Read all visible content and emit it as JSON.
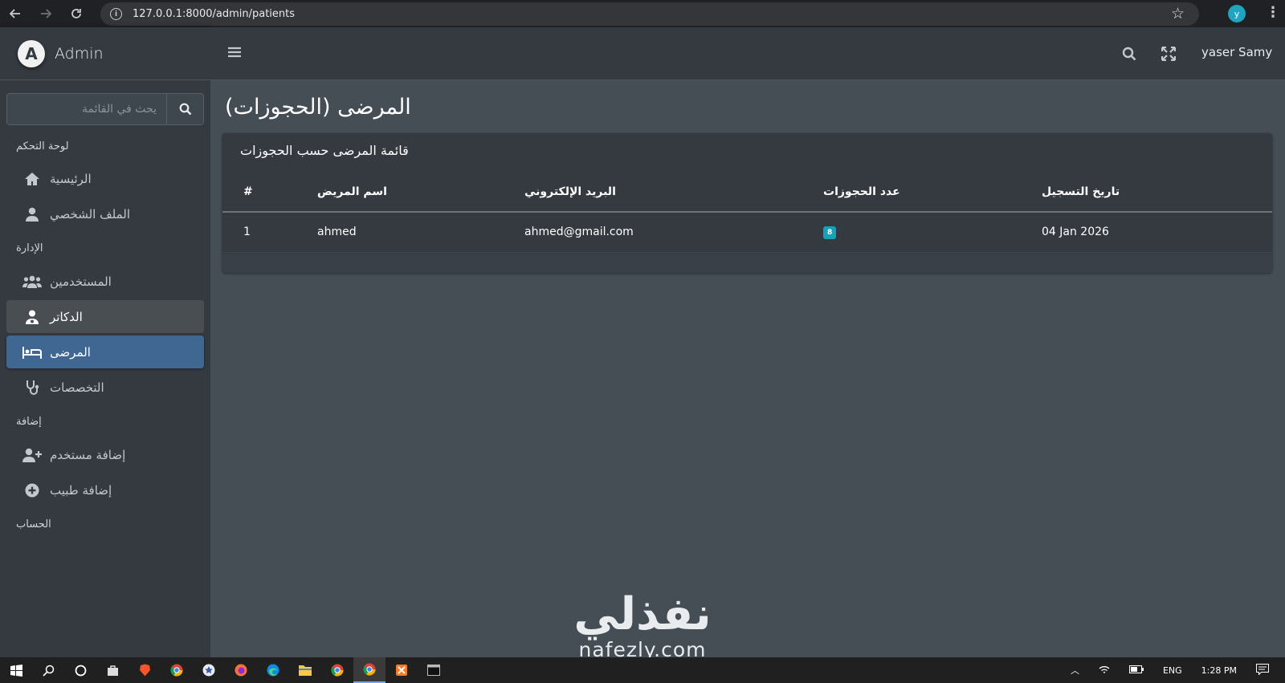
{
  "browser": {
    "url": "127.0.0.1:8000/admin/patients",
    "profile_initial": "y"
  },
  "brand": {
    "logo_letter": "A",
    "name": "Admin"
  },
  "sidebar": {
    "search_placeholder": "يحث في القائمة",
    "sections": [
      {
        "header": "لوحة التحكم",
        "items": [
          {
            "label": "الرئيسية",
            "icon": "home-icon"
          },
          {
            "label": "الملف الشخصي",
            "icon": "user-icon"
          }
        ]
      },
      {
        "header": "الإدارة",
        "items": [
          {
            "label": "المستخدمين",
            "icon": "users-icon"
          },
          {
            "label": "الدكاتر",
            "icon": "doctor-icon",
            "state": "hover"
          },
          {
            "label": "المرضى",
            "icon": "bed-icon",
            "state": "active"
          },
          {
            "label": "التخصصات",
            "icon": "stethoscope-icon"
          }
        ]
      },
      {
        "header": "إضافة",
        "items": [
          {
            "label": "إضافة مستخدم",
            "icon": "user-plus-icon"
          },
          {
            "label": "إضافة طبيب",
            "icon": "plus-circle-icon"
          }
        ]
      },
      {
        "header": "الحساب",
        "items": []
      }
    ]
  },
  "topnav": {
    "user_name": "yaser Samy"
  },
  "page": {
    "title": "المرضى (الحجوزات)"
  },
  "card": {
    "title": "قائمة المرضى حسب الحجوزات",
    "columns": [
      "#",
      "اسم المريض",
      "البريد الإلكتروني",
      "عدد الحجوزات",
      "تاريخ التسجيل"
    ],
    "rows": [
      {
        "index": "1",
        "name": "ahmed",
        "email": "ahmed@gmail.com",
        "bookings": "8",
        "registered": "04 Jan 2026"
      }
    ]
  },
  "watermark": {
    "arabic": "نفذلي",
    "latin": "nafezly.com"
  },
  "taskbar": {
    "language": "ENG",
    "time": "1:28 PM"
  },
  "colors": {
    "sidebar_bg": "#343a40",
    "content_bg": "#454d55",
    "active_item": "#3f6791",
    "badge": "#17a2b8"
  }
}
